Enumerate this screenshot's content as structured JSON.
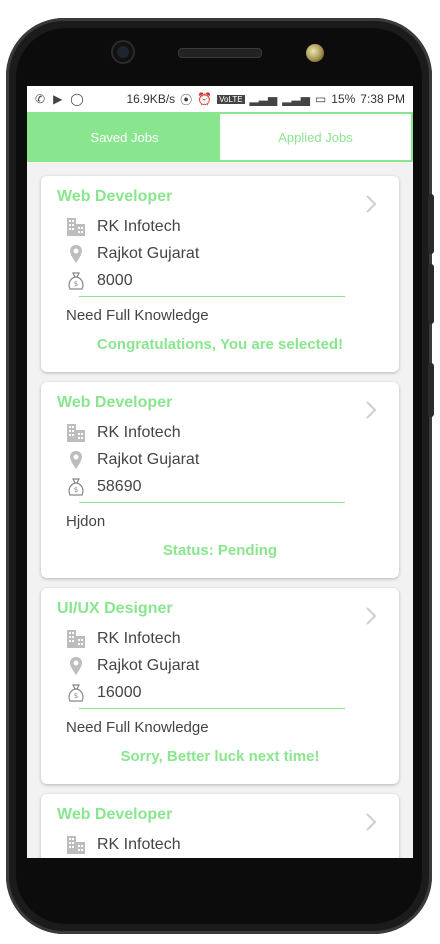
{
  "statusbar": {
    "speed": "16.9KB/s",
    "network": "VoLTE",
    "battery": "15%",
    "time": "7:38 PM"
  },
  "tabs": [
    {
      "label": "Saved Jobs",
      "active": true
    },
    {
      "label": "Applied Jobs",
      "active": false
    }
  ],
  "jobs": [
    {
      "title": "Web Developer",
      "company": "RK Infotech",
      "location": "Rajkot Gujarat",
      "salary": "8000",
      "description": "Need Full Knowledge",
      "status": "Congratulations, You are selected!"
    },
    {
      "title": "Web Developer",
      "company": "RK Infotech",
      "location": "Rajkot Gujarat",
      "salary": "58690",
      "description": "Hjdon",
      "status": "Status: Pending"
    },
    {
      "title": "UI/UX Designer",
      "company": "RK Infotech",
      "location": "Rajkot Gujarat",
      "salary": "16000",
      "description": "Need Full Knowledge",
      "status": "Sorry, Better luck next time!"
    },
    {
      "title": "Web Developer",
      "company": "RK Infotech",
      "location": "",
      "salary": "",
      "description": "",
      "status": ""
    }
  ],
  "colors": {
    "accent": "#8ae68e",
    "icon": "#bdbdbd"
  }
}
